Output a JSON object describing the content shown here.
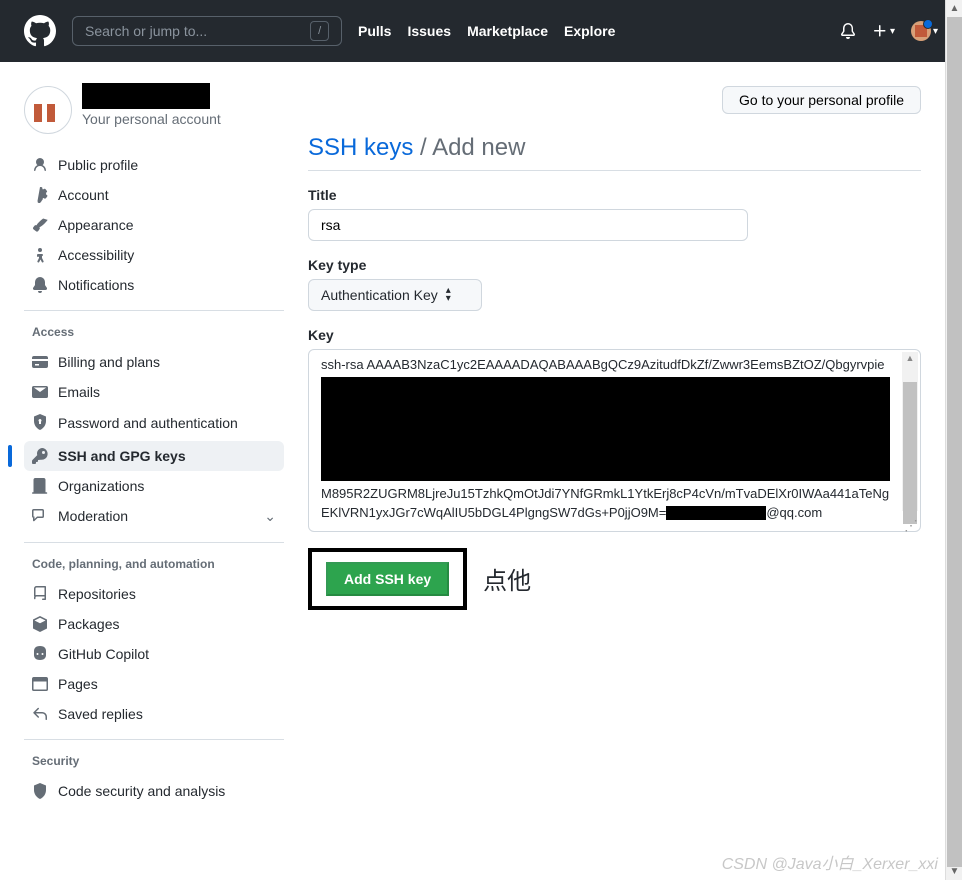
{
  "header": {
    "search_placeholder": "Search or jump to...",
    "slash": "/",
    "nav": {
      "pulls": "Pulls",
      "issues": "Issues",
      "marketplace": "Marketplace",
      "explore": "Explore"
    }
  },
  "profile": {
    "subtitle": "Your personal account",
    "go_button": "Go to your personal profile"
  },
  "sidebar": {
    "section_access": "Access",
    "section_code": "Code, planning, and automation",
    "section_security": "Security",
    "items": {
      "public_profile": "Public profile",
      "account": "Account",
      "appearance": "Appearance",
      "accessibility": "Accessibility",
      "notifications": "Notifications",
      "billing": "Billing and plans",
      "emails": "Emails",
      "password": "Password and authentication",
      "ssh": "SSH and GPG keys",
      "orgs": "Organizations",
      "moderation": "Moderation",
      "repos": "Repositories",
      "packages": "Packages",
      "copilot": "GitHub Copilot",
      "pages": "Pages",
      "saved": "Saved replies",
      "code_security": "Code security and analysis"
    }
  },
  "page": {
    "breadcrumb_link": "SSH keys",
    "breadcrumb_sep": "/",
    "breadcrumb_current": "Add new",
    "title_label": "Title",
    "title_value": "rsa",
    "keytype_label": "Key type",
    "keytype_value": "Authentication Key",
    "key_label": "Key",
    "key_line1": "ssh-rsa",
    "key_line2": "AAAAB3NzaC1yc2EAAAADAQABAAABgQCz9AzitudfDkZf/Zwwr3EemsBZtOZ/Qbgyrvpie",
    "key_line3": "M895R2ZUGRM8LjreJu15TzhkQmOtJdi7YNfGRmkL1YtkErj8cP4cVn/mTvaDElXr0IWAa441aTeNgEKlVRN1yxJGr7cWqAlIU5bDGL4PlgngSW7dGs+P0jjO9M=",
    "key_email": "@qq.com",
    "submit": "Add SSH key",
    "annotation": "点他"
  },
  "watermark": "CSDN @Java小白_Xerxer_xxi"
}
